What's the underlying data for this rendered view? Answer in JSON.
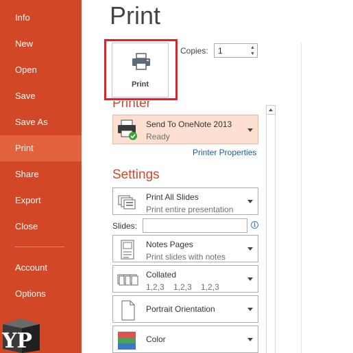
{
  "sidebar": {
    "items": [
      {
        "label": "Info"
      },
      {
        "label": "New"
      },
      {
        "label": "Open"
      },
      {
        "label": "Save"
      },
      {
        "label": "Save As"
      },
      {
        "label": "Print",
        "active": true
      },
      {
        "label": "Share"
      },
      {
        "label": "Export"
      },
      {
        "label": "Close"
      },
      {
        "label": "Account"
      },
      {
        "label": "Options"
      }
    ]
  },
  "logo": {
    "text": "YP"
  },
  "main": {
    "title": "Print",
    "print_button": {
      "label": "Print",
      "icon": "printer-icon"
    },
    "copies": {
      "label": "Copies:",
      "value": "1"
    },
    "printer": {
      "heading": "Printer",
      "name": "Send To OneNote 2013",
      "status": "Ready",
      "properties_link": "Printer Properties"
    },
    "settings": {
      "heading": "Settings",
      "slides_label": "Slides:",
      "slides_value": "",
      "options": [
        {
          "primary": "Print All Slides",
          "secondary": "Print entire presentation",
          "icon": "all-slides-icon"
        },
        {
          "primary": "Notes Pages",
          "secondary": "Print slides with notes",
          "icon": "notes-pages-icon"
        },
        {
          "primary": "Collated",
          "secondary": "1,2,3    1,2,3    1,2,3",
          "icon": "collated-icon"
        },
        {
          "primary": "Portrait Orientation",
          "secondary": "",
          "icon": "portrait-icon"
        },
        {
          "primary": "Color",
          "secondary": "",
          "icon": "color-icon"
        }
      ]
    }
  },
  "colors": {
    "sidebar_bg": "#d24726",
    "sidebar_active": "#e3623e",
    "accent": "#d24726",
    "highlight_box": "#e0202a",
    "link": "#1d5d99"
  }
}
